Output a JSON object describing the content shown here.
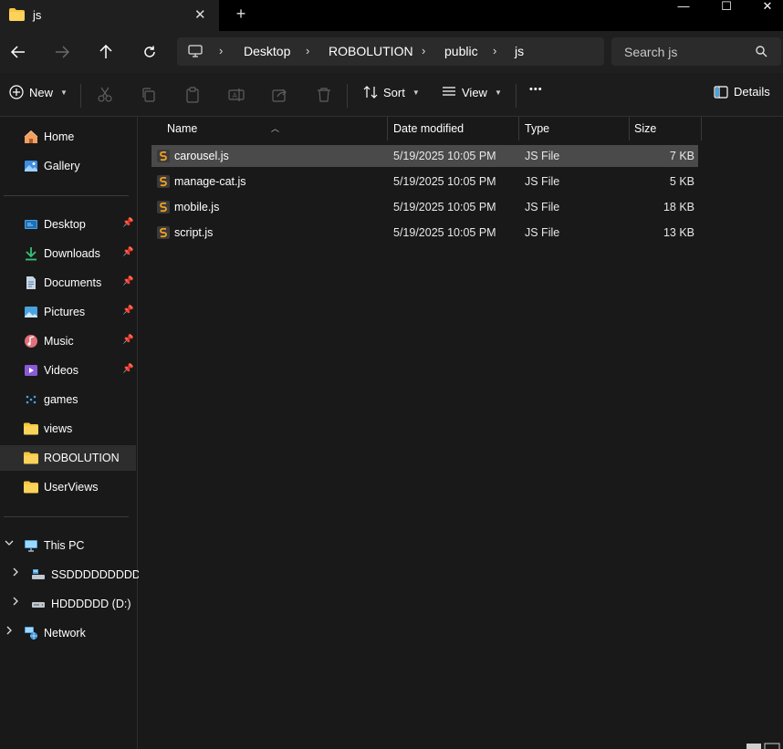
{
  "window": {
    "tab_title": "js",
    "tab_close": "✕",
    "new_tab": "+",
    "minimize": "—",
    "maximize": "☐",
    "close": "✕"
  },
  "address": {
    "breadcrumbs": [
      "Desktop",
      "ROBOLUTION",
      "public",
      "js"
    ],
    "separator": "›",
    "search_placeholder": "Search js"
  },
  "toolbar": {
    "new_label": "New",
    "sort_label": "Sort",
    "view_label": "View",
    "more_label": "•••",
    "details_label": "Details",
    "disabled_actions": [
      "cut-icon",
      "copy-icon",
      "paste-icon",
      "rename-icon",
      "share-icon",
      "delete-icon"
    ]
  },
  "sidebar": {
    "quick": [
      {
        "label": "Home",
        "icon": "home-icon"
      },
      {
        "label": "Gallery",
        "icon": "gallery-icon"
      }
    ],
    "pinned": [
      {
        "label": "Desktop",
        "icon": "desktop-folder-icon",
        "pinned": true
      },
      {
        "label": "Downloads",
        "icon": "downloads-icon",
        "pinned": true
      },
      {
        "label": "Documents",
        "icon": "documents-icon",
        "pinned": true
      },
      {
        "label": "Pictures",
        "icon": "pictures-icon",
        "pinned": true
      },
      {
        "label": "Music",
        "icon": "music-icon",
        "pinned": true
      },
      {
        "label": "Videos",
        "icon": "videos-icon",
        "pinned": true
      },
      {
        "label": "games",
        "icon": "games-icon",
        "pinned": false
      },
      {
        "label": "views",
        "icon": "folder-icon",
        "pinned": false
      },
      {
        "label": "ROBOLUTION",
        "icon": "folder-icon",
        "pinned": false,
        "selected": true
      },
      {
        "label": "UserViews",
        "icon": "folder-icon",
        "pinned": false
      }
    ],
    "this_pc": {
      "label": "This PC",
      "icon": "this-pc-icon"
    },
    "drives": [
      {
        "label": "SSDDDDDDDDDD",
        "icon": "ssd-drive-icon"
      },
      {
        "label": "HDDDDDD (D:)",
        "icon": "hdd-drive-icon"
      }
    ],
    "network": {
      "label": "Network",
      "icon": "network-icon"
    }
  },
  "columns": {
    "name": "Name",
    "date": "Date modified",
    "type": "Type",
    "size": "Size"
  },
  "files": [
    {
      "name": "carousel.js",
      "date": "5/19/2025 10:05 PM",
      "type": "JS File",
      "size": "7 KB",
      "selected": true
    },
    {
      "name": "manage-cat.js",
      "date": "5/19/2025 10:05 PM",
      "type": "JS File",
      "size": "5 KB",
      "selected": false
    },
    {
      "name": "mobile.js",
      "date": "5/19/2025 10:05 PM",
      "type": "JS File",
      "size": "18 KB",
      "selected": false
    },
    {
      "name": "script.js",
      "date": "5/19/2025 10:05 PM",
      "type": "JS File",
      "size": "13 KB",
      "selected": false
    }
  ],
  "colors": {
    "accent_folder": "#f8c640",
    "js_file": "#f0a020",
    "selected_row": "#4a4a4a"
  }
}
